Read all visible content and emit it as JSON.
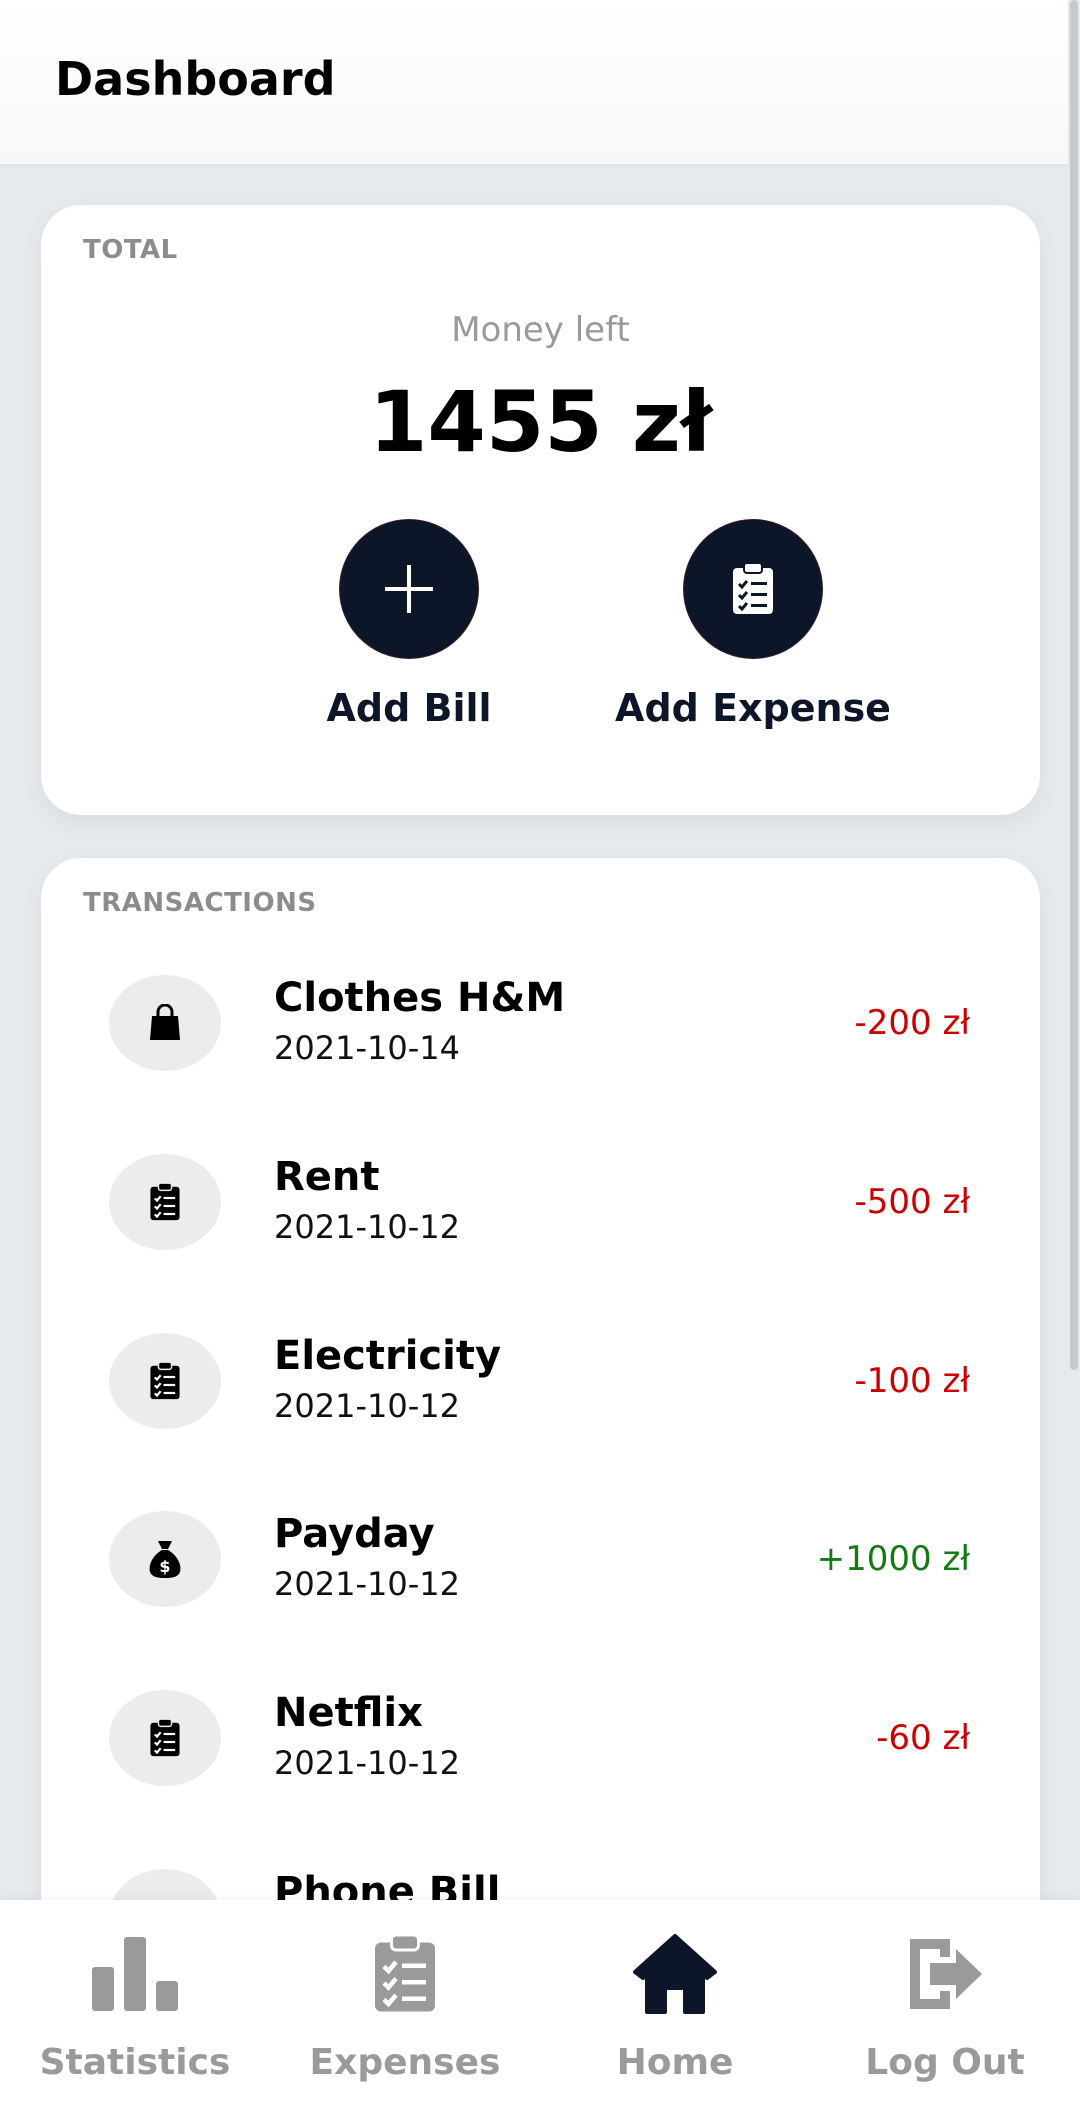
{
  "header": {
    "title": "Dashboard"
  },
  "total": {
    "section_label": "TOTAL",
    "money_label": "Money left",
    "money_value": "1455 zł",
    "actions": [
      {
        "label": "Add Bill",
        "icon": "plus-icon"
      },
      {
        "label": "Add Expense",
        "icon": "clipboard-check-icon"
      }
    ]
  },
  "transactions": {
    "section_label": "TRANSACTIONS",
    "items": [
      {
        "name": "Clothes H&M",
        "date": "2021-10-14",
        "amount": "-200 zł",
        "type": "negative",
        "icon": "shopping-bag-icon"
      },
      {
        "name": "Rent",
        "date": "2021-10-12",
        "amount": "-500 zł",
        "type": "negative",
        "icon": "clipboard-check-icon"
      },
      {
        "name": "Electricity",
        "date": "2021-10-12",
        "amount": "-100 zł",
        "type": "negative",
        "icon": "clipboard-check-icon"
      },
      {
        "name": "Payday",
        "date": "2021-10-12",
        "amount": "+1000 zł",
        "type": "positive",
        "icon": "money-bag-icon"
      },
      {
        "name": "Netflix",
        "date": "2021-10-12",
        "amount": "-60 zł",
        "type": "negative",
        "icon": "clipboard-check-icon"
      },
      {
        "name": "Phone Bill",
        "date": "",
        "amount": "",
        "type": "negative",
        "icon": "clipboard-check-icon"
      }
    ]
  },
  "nav": {
    "items": [
      {
        "label": "Statistics",
        "icon": "bar-chart-icon",
        "active": false
      },
      {
        "label": "Expenses",
        "icon": "clipboard-check-icon",
        "active": false
      },
      {
        "label": "Home",
        "icon": "home-icon",
        "active": true
      },
      {
        "label": "Log Out",
        "icon": "logout-icon",
        "active": false
      }
    ]
  },
  "colors": {
    "accent": "#0c1628",
    "negative": "#cc0000",
    "positive": "#137a13",
    "muted": "#9a9a9a"
  }
}
